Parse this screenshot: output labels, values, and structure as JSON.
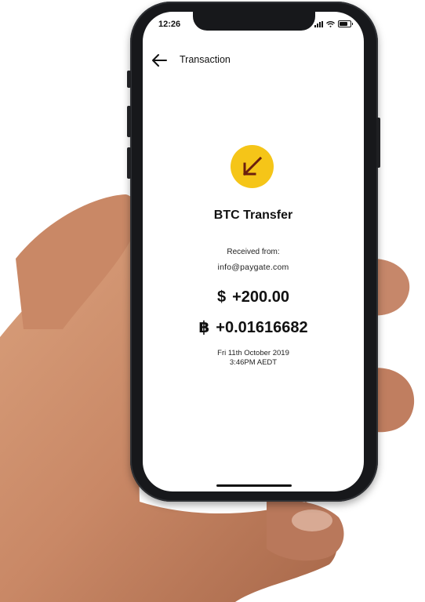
{
  "status_bar": {
    "time": "12:26"
  },
  "header": {
    "back_icon": "arrow-left-icon",
    "title": "Transaction"
  },
  "transaction": {
    "icon": "arrow-down-left-icon",
    "icon_color": "#f5c518",
    "icon_arrow_color": "#6b1f0e",
    "title": "BTC Transfer",
    "received_label": "Received from:",
    "sender": "info@paygate.com",
    "usd_symbol": "$",
    "usd_amount": "+200.00",
    "btc_symbol": "฿",
    "btc_amount": "+0.01616682",
    "date": "Fri 11th October 2019",
    "time": "3:46PM AEDT"
  }
}
